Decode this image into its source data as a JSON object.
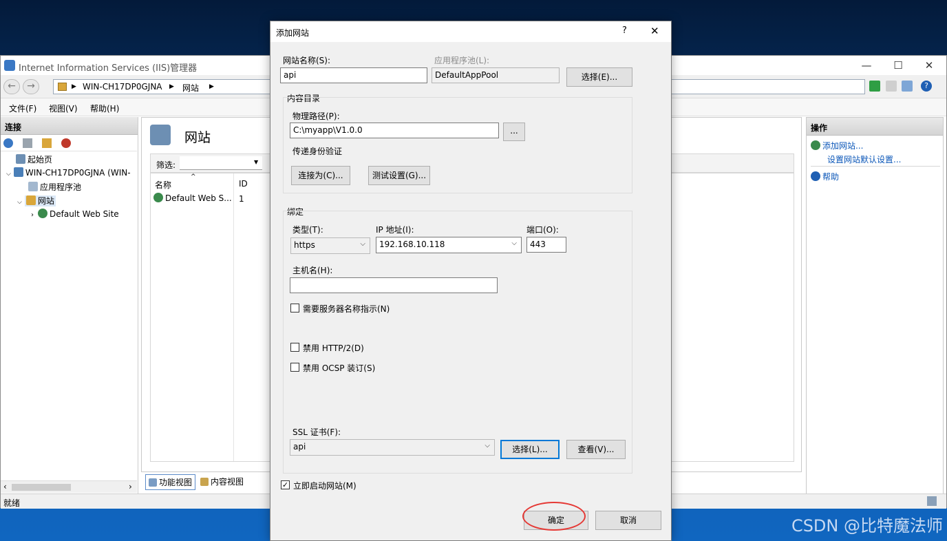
{
  "iis": {
    "title": "Internet Information Services (IIS)管理器",
    "window_controls": {
      "minimize": "—",
      "maximize": "☐",
      "close": "✕"
    },
    "breadcrumb": [
      "WIN-CH17DP0GJNA",
      "网站"
    ],
    "menu": [
      "文件(F)",
      "视图(V)",
      "帮助(H)"
    ],
    "connections": {
      "header": "连接",
      "tree": [
        "起始页",
        "WIN-CH17DP0GJNA (WIN-",
        "应用程序池",
        "网站",
        "Default Web Site"
      ]
    },
    "center": {
      "title": "网站",
      "filter_label": "筛选:",
      "columns": [
        "名称",
        "ID"
      ],
      "rows": [
        {
          "name": "Default Web S...",
          "id": "1"
        }
      ],
      "tabs": [
        "功能视图",
        "内容视图"
      ]
    },
    "actions": {
      "header": "操作",
      "items": [
        "添加网站...",
        "设置网站默认设置...",
        "帮助"
      ]
    },
    "status": "就绪"
  },
  "dialog": {
    "title": "添加网站",
    "help": "?",
    "close": "✕",
    "site_name_label": "网站名称(S):",
    "site_name_value": "api",
    "app_pool_label": "应用程序池(L):",
    "app_pool_value": "DefaultAppPool",
    "select_pool_button": "选择(E)...",
    "content_dir_label": "内容目录",
    "physical_path_label": "物理路径(P):",
    "physical_path_value": "C:\\myapp\\V1.0.0",
    "browse_button": "...",
    "pass_auth_label": "传递身份验证",
    "connect_as_button": "连接为(C)...",
    "test_settings_button": "测试设置(G)...",
    "binding_label": "绑定",
    "type_label": "类型(T):",
    "type_value": "https",
    "ip_label": "IP 地址(I):",
    "ip_value": "192.168.10.118",
    "port_label": "端口(O):",
    "port_value": "443",
    "host_label": "主机名(H):",
    "host_value": "",
    "sni_label": "需要服务器名称指示(N)",
    "disable_http2_label": "禁用 HTTP/2(D)",
    "disable_ocsp_label": "禁用 OCSP 装订(S)",
    "ssl_label": "SSL 证书(F):",
    "ssl_value": "api",
    "ssl_select_button": "选择(L)...",
    "ssl_view_button": "查看(V)...",
    "start_now_label": "立即启动网站(M)",
    "start_now_checked": "✓",
    "ok_button": "确定",
    "cancel_button": "取消"
  },
  "watermark": "CSDN @比特魔法师",
  "colors": {
    "accent": "#0078d7",
    "annotation": "#e53935",
    "link": "#0a56b8"
  }
}
